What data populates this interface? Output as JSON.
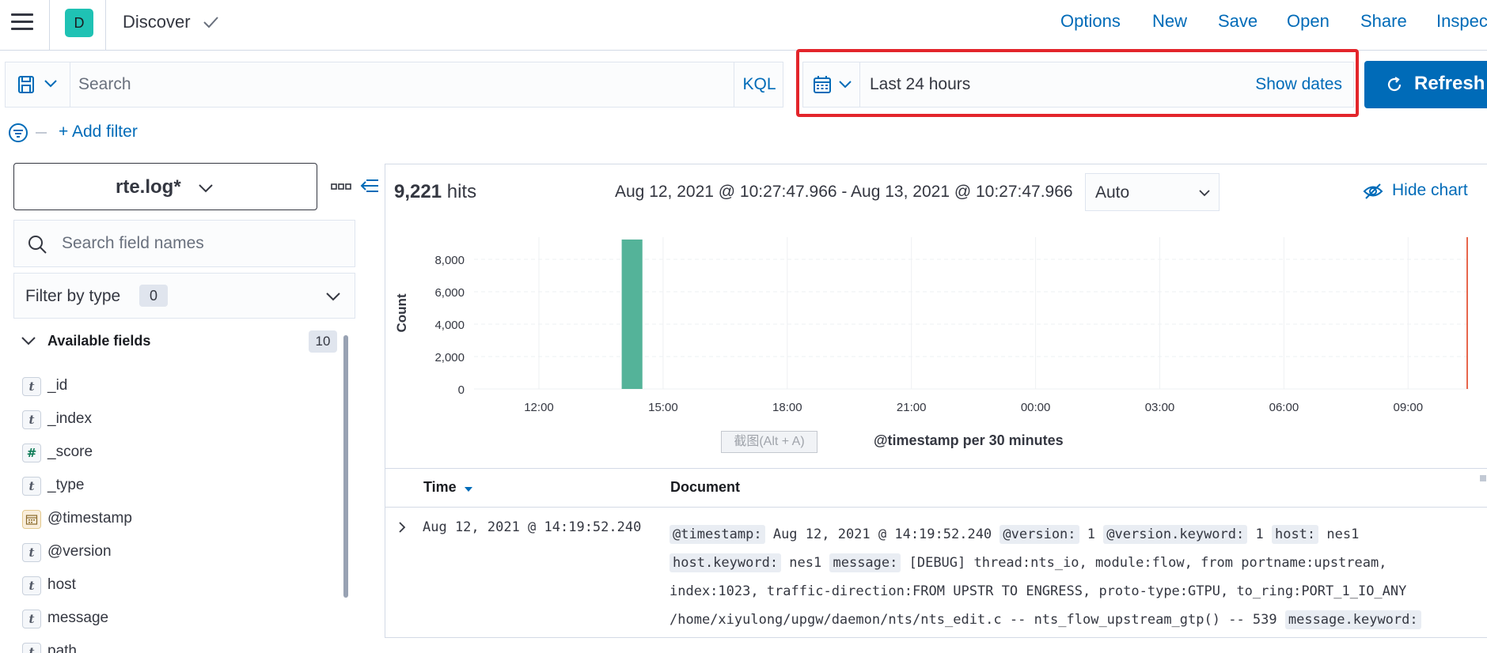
{
  "header": {
    "space_initial": "D",
    "breadcrumb": "Discover",
    "menu": [
      "Options",
      "New",
      "Save",
      "Open",
      "Share",
      "Inspec"
    ]
  },
  "query": {
    "placeholder": "Search",
    "language": "KQL"
  },
  "time": {
    "range": "Last 24 hours",
    "show_dates": "Show dates",
    "refresh": "Refresh"
  },
  "filters": {
    "add_filter": "+ Add filter"
  },
  "sidebar": {
    "index_pattern": "rte.log*",
    "field_search_placeholder": "Search field names",
    "filter_by_type": "Filter by type",
    "filter_count": "0",
    "available_label": "Available fields",
    "available_count": "10",
    "fields": [
      {
        "name": "_id",
        "type": "t"
      },
      {
        "name": "_index",
        "type": "t"
      },
      {
        "name": "_score",
        "type": "#"
      },
      {
        "name": "_type",
        "type": "t"
      },
      {
        "name": "@timestamp",
        "type": "date"
      },
      {
        "name": "@version",
        "type": "t"
      },
      {
        "name": "host",
        "type": "t"
      },
      {
        "name": "message",
        "type": "t"
      },
      {
        "name": "path",
        "type": "t"
      }
    ]
  },
  "results": {
    "hits_count": "9,221",
    "hits_label": "hits",
    "date_range": "Aug 12, 2021 @ 10:27:47.966 - Aug 13, 2021 @ 10:27:47.966",
    "interval": "Auto",
    "hide_chart": "Hide chart",
    "screenshot_hint": "截图(Alt + A)"
  },
  "chart_data": {
    "type": "bar",
    "xlabel": "@timestamp per 30 minutes",
    "ylabel": "Count",
    "y_ticks": [
      "0",
      "2,000",
      "4,000",
      "6,000",
      "8,000"
    ],
    "x_ticks": [
      "12:00",
      "15:00",
      "18:00",
      "21:00",
      "00:00",
      "03:00",
      "06:00",
      "09:00"
    ],
    "ylim": [
      0,
      9221
    ],
    "bars": [
      {
        "x": "14:00",
        "value": 9221
      }
    ],
    "bar_color": "#54b399",
    "now_marker_color": "#e7664c"
  },
  "table": {
    "col_time": "Time",
    "col_document": "Document",
    "rows": [
      {
        "time": "Aug 12, 2021 @ 14:19:52.240",
        "doc": [
          {
            "k": "@timestamp:",
            "v": "Aug 12, 2021 @ 14:19:52.240"
          },
          {
            "k": "@version:",
            "v": "1"
          },
          {
            "k": "@version.keyword:",
            "v": "1"
          },
          {
            "k": "host:",
            "v": "nes1"
          },
          {
            "k": "host.keyword:",
            "v": "nes1"
          },
          {
            "k": "message:",
            "v": "[DEBUG] thread:nts_io, module:flow, from portname:upstream, index:1023, traffic-direction:FROM UPSTR TO ENGRESS, proto-type:GTPU, to_ring:PORT_1_IO_ANY /home/xiyulong/upgw/daemon/nts/nts_edit.c -- nts_flow_upstream_gtp() -- 539"
          },
          {
            "k": "message.keyword:",
            "v": ""
          }
        ]
      }
    ]
  }
}
